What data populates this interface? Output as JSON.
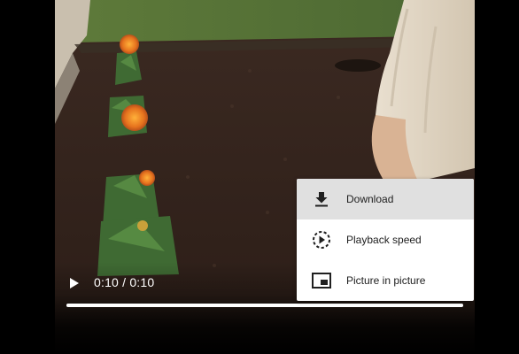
{
  "player": {
    "time_display": "0:10 / 0:10",
    "progress_fraction": 1.0
  },
  "menu": {
    "items": [
      {
        "label": "Download",
        "icon": "download-icon",
        "highlighted": true
      },
      {
        "label": "Playback speed",
        "icon": "playback-speed-icon",
        "highlighted": false
      },
      {
        "label": "Picture in picture",
        "icon": "picture-in-picture-icon",
        "highlighted": false
      }
    ]
  },
  "colors": {
    "menu_background": "#ffffff",
    "menu_highlight": "#e0e0e0",
    "menu_text": "#202020",
    "control_text": "#ffffff",
    "progress_fill": "#ffffff"
  }
}
